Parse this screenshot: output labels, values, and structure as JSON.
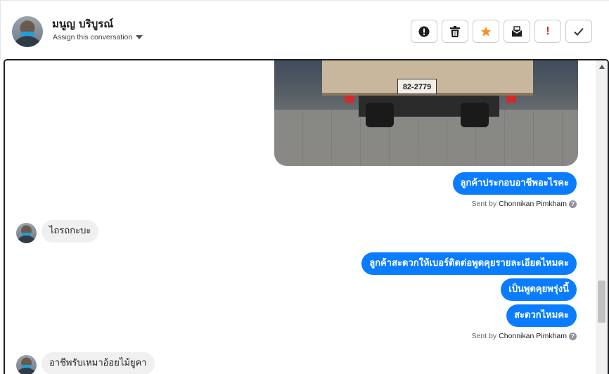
{
  "header": {
    "contact_name": "มนูญ บริบูรณ์",
    "assign_label": "Assign this conversation"
  },
  "toolbar": {
    "buttons": [
      {
        "icon": "alert-circle-icon"
      },
      {
        "icon": "trash-icon"
      },
      {
        "icon": "star-icon",
        "color": "#f5922b"
      },
      {
        "icon": "archive-envelope-icon"
      },
      {
        "icon": "exclamation-icon",
        "glyph": "!",
        "color": "#e02020"
      },
      {
        "icon": "checkmark-icon"
      }
    ]
  },
  "attachment": {
    "plate_text": "82-2779"
  },
  "messages": {
    "m1": "ลูกค้าประกอบอาชีพอะไรคะ",
    "m1_sent_prefix": "Sent by",
    "m1_sent_by": "Chonnikan Pimkham",
    "m2": "ไถรถกะบะ",
    "m3": "ลูกค้าสะดวกให้เบอร์ติดต่อพูดคุยรายละเอียดไหมคะ",
    "m4": "เป็นพูดคุยพรุ่งนี้",
    "m5": "สะดวกไหมคะ",
    "m5_sent_prefix": "Sent by",
    "m5_sent_by": "Chonnikan Pimkham",
    "m6": "อาชีพรับเหมาอ้อยไม้ยูคา"
  },
  "colors": {
    "outgoing_bubble": "#0a7cff",
    "incoming_bubble": "#f0f0f0"
  }
}
